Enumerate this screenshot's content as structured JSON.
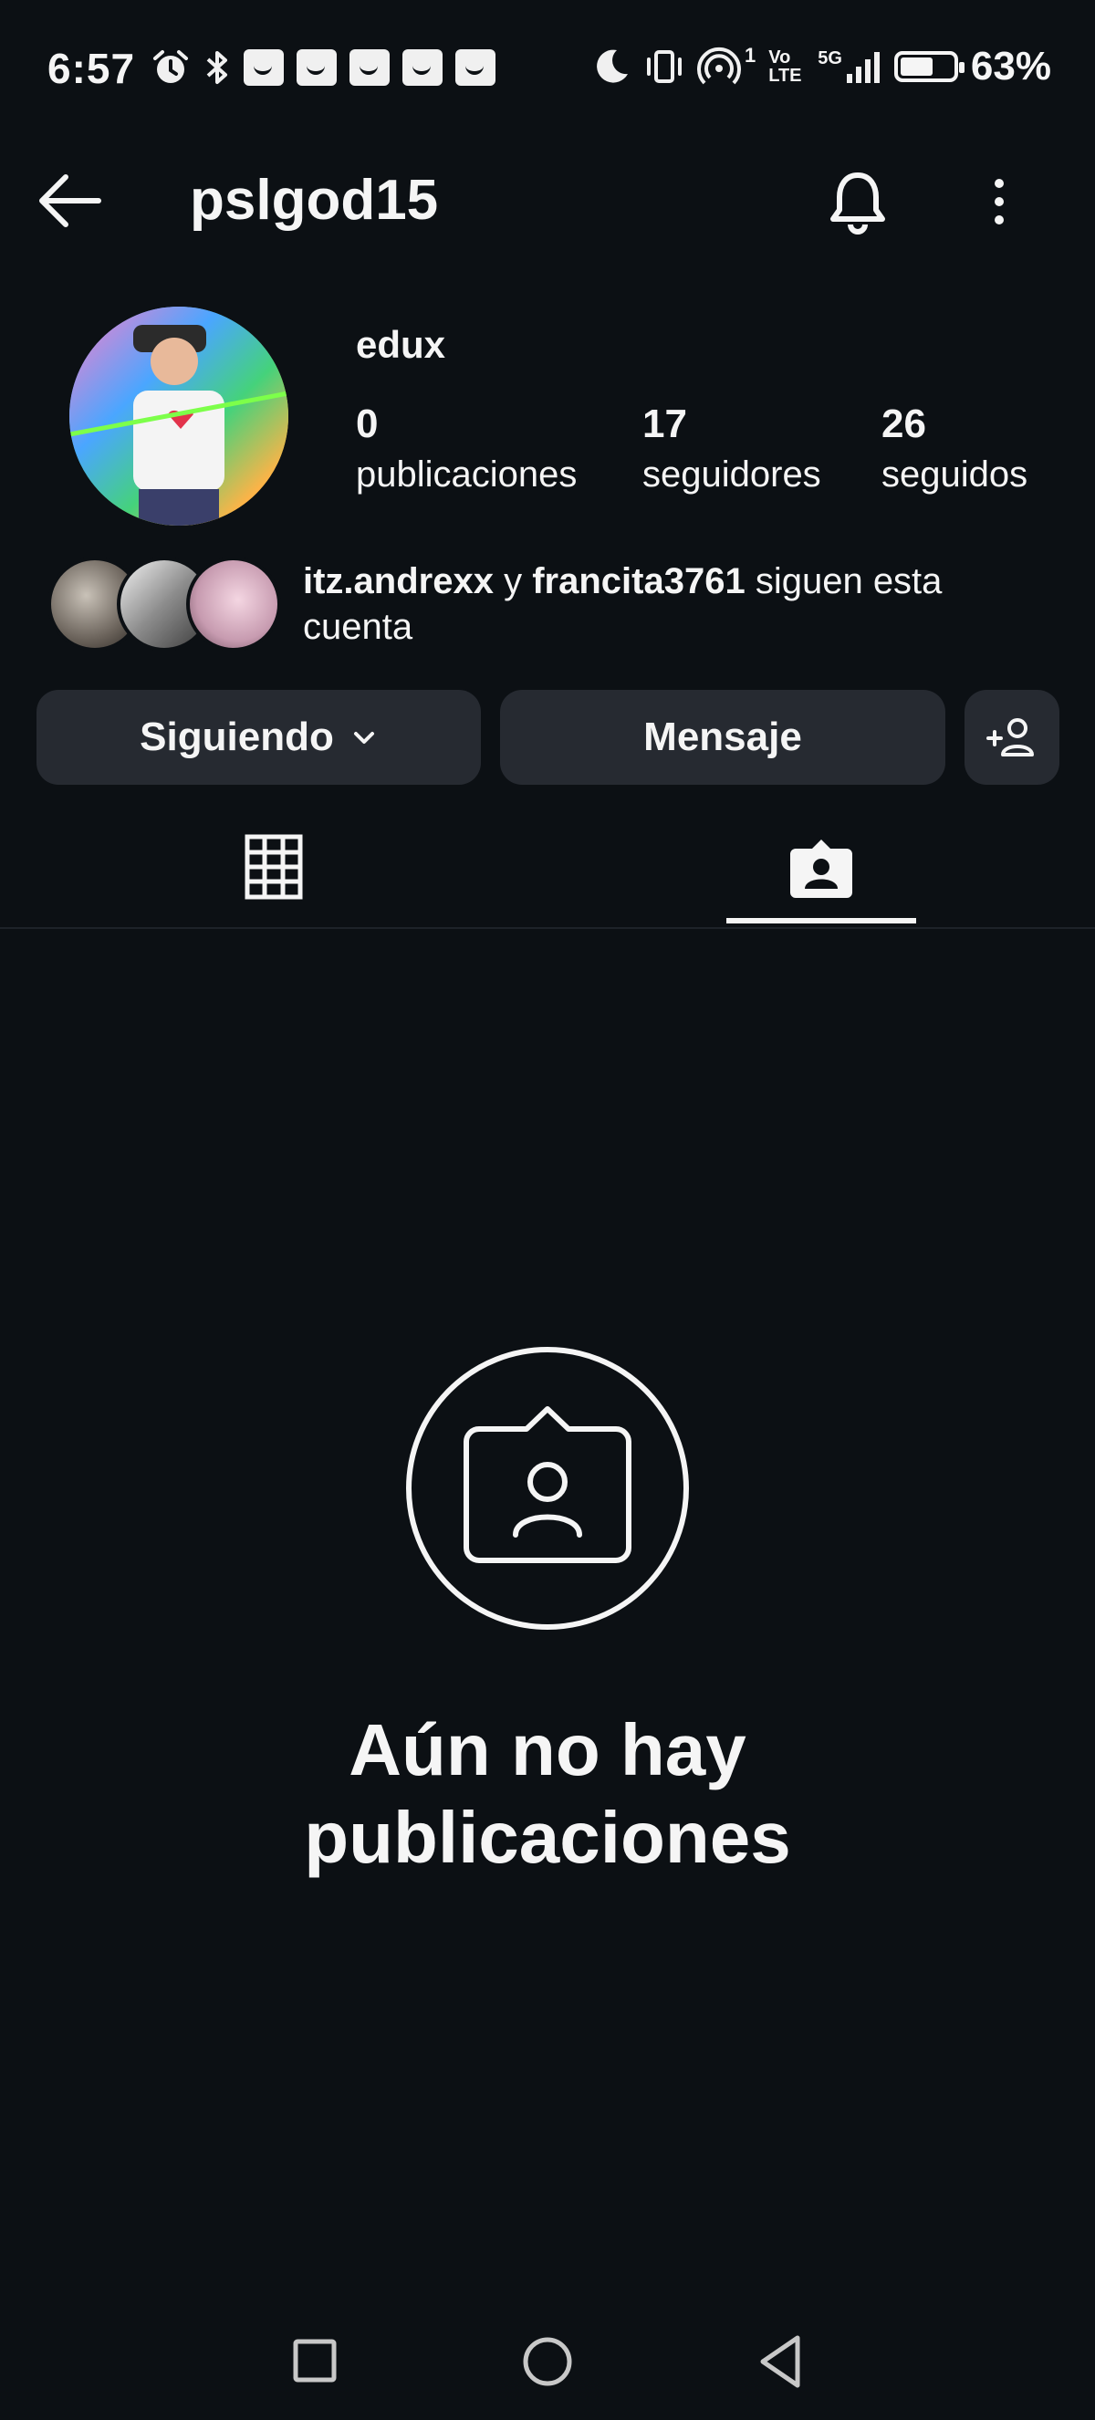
{
  "status_bar": {
    "time": "6:57",
    "network_small": "1",
    "volte": "Vo LTE",
    "network_type": "5G",
    "battery_percent_text": "63%",
    "battery_level": 0.63
  },
  "header": {
    "username": "pslgod15"
  },
  "profile": {
    "display_name": "edux",
    "stats": [
      {
        "value": "0",
        "label": "publicaciones"
      },
      {
        "value": "17",
        "label": "seguidores"
      },
      {
        "value": "26",
        "label": "seguidos"
      }
    ],
    "mutuals": {
      "user1": "itz.andrexx",
      "connector": "y",
      "user2": "francita3761",
      "suffix": "siguen esta cuenta"
    }
  },
  "actions": {
    "following_label": "Siguiendo",
    "message_label": "Mensaje"
  },
  "empty_state": {
    "title": "Aún no hay publicaciones"
  },
  "colors": {
    "background": "#0c1014",
    "button_bg": "#262a31",
    "text": "#f5f5f5"
  }
}
